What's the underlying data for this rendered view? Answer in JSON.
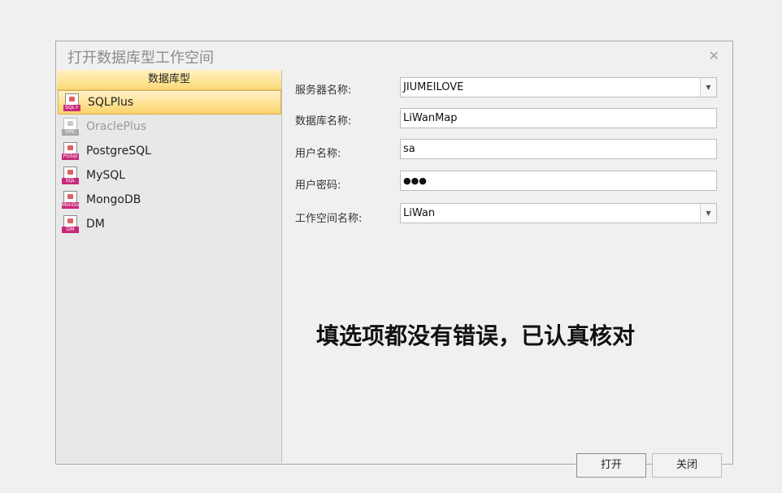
{
  "dialog": {
    "title": "打开数据库型工作空间",
    "close_symbol": "✕"
  },
  "left_panel": {
    "header": "数据库型",
    "items": [
      {
        "label": "SQLPlus",
        "tag": "SQL+",
        "selected": true,
        "disabled": false
      },
      {
        "label": "OraclePlus",
        "tag": "ORC",
        "selected": false,
        "disabled": true
      },
      {
        "label": "PostgreSQL",
        "tag": "PGSql",
        "selected": false,
        "disabled": false
      },
      {
        "label": "MySQL",
        "tag": "SQL",
        "selected": false,
        "disabled": false
      },
      {
        "label": "MongoDB",
        "tag": "MonGo",
        "selected": false,
        "disabled": false
      },
      {
        "label": "DM",
        "tag": "DM",
        "selected": false,
        "disabled": false
      }
    ]
  },
  "form": {
    "server_label": "服务器名称:",
    "server_value": "JIUMEILOVE",
    "db_label": "数据库名称:",
    "db_value": "LiWanMap",
    "user_label": "用户名称:",
    "user_value": "sa",
    "password_label": "用户密码:",
    "password_value": "●●●",
    "workspace_label": "工作空间名称:",
    "workspace_value": "LiWan"
  },
  "note": "填选项都没有错误，已认真核对",
  "buttons": {
    "open": "打开",
    "close": "关闭"
  },
  "colors": {
    "selection_top": "#fff3c9",
    "selection_bottom": "#fcd36a",
    "tag_magenta": "#c8287a"
  }
}
